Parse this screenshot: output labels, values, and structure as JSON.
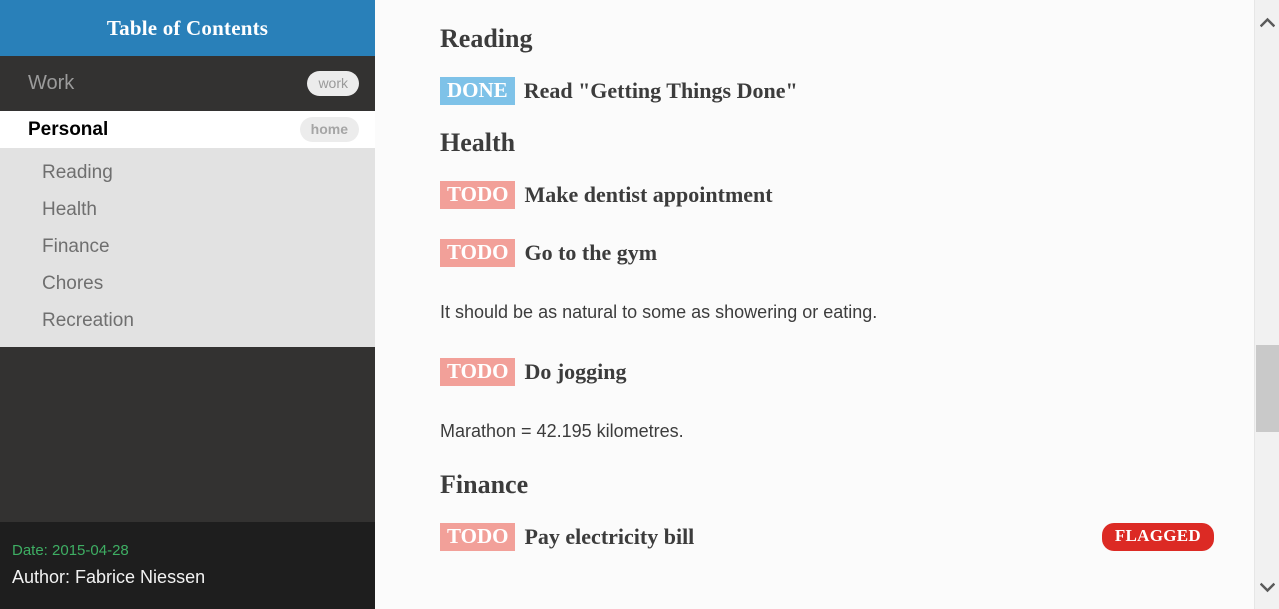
{
  "sidebar": {
    "header_title": "Table of Contents",
    "top_items": [
      {
        "label": "Work",
        "tag": "work",
        "active": false
      },
      {
        "label": "Personal",
        "tag": "home",
        "active": true
      }
    ],
    "sub_items": [
      {
        "label": "Reading"
      },
      {
        "label": "Health"
      },
      {
        "label": "Finance"
      },
      {
        "label": "Chores"
      },
      {
        "label": "Recreation"
      }
    ],
    "footer": {
      "date": "Date: 2015-04-28",
      "author": "Author: Fabrice Niessen"
    }
  },
  "content": {
    "blocks": [
      {
        "kind": "heading",
        "text": "Reading"
      },
      {
        "kind": "task",
        "keyword": "DONE",
        "title": "Read \"Getting Things Done\"",
        "flag": ""
      },
      {
        "kind": "heading",
        "text": "Health"
      },
      {
        "kind": "task",
        "keyword": "TODO",
        "title": "Make dentist appointment",
        "flag": ""
      },
      {
        "kind": "task",
        "keyword": "TODO",
        "title": "Go to the gym",
        "flag": ""
      },
      {
        "kind": "para",
        "text": "It should be as natural to some as showering or eating."
      },
      {
        "kind": "task",
        "keyword": "TODO",
        "title": "Do jogging",
        "flag": ""
      },
      {
        "kind": "para",
        "text": "Marathon = 42.195 kilometres."
      },
      {
        "kind": "heading",
        "text": "Finance"
      },
      {
        "kind": "task",
        "keyword": "TODO",
        "title": "Pay electricity bill",
        "flag": "FLAGGED"
      }
    ]
  },
  "scrollbar": {
    "up_icon": "chevron-up-icon",
    "down_icon": "chevron-down-icon"
  },
  "colors": {
    "header_blue": "#2980b9",
    "sidebar_dark": "#333231",
    "footer_dark": "#1e1e1e",
    "sublist_gray": "#e2e2e2",
    "todo_pink": "#f2a099",
    "done_blue": "#7ec2e8",
    "flagged_red": "#dc2a24",
    "date_green": "#3eae63"
  }
}
